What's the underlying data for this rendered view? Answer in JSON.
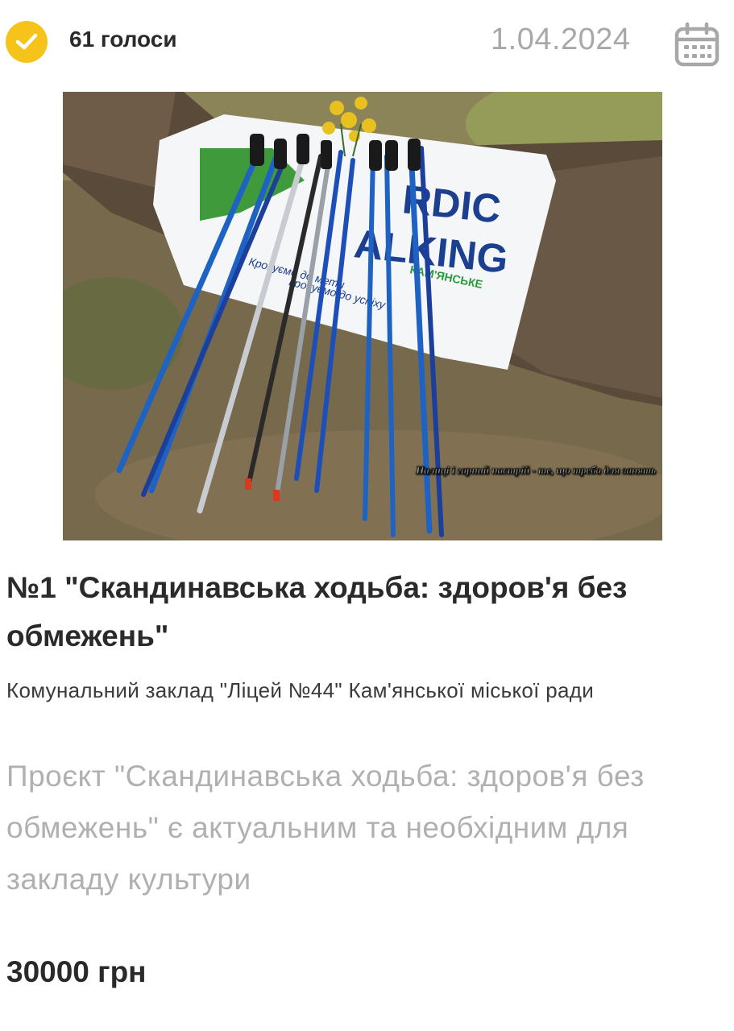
{
  "header": {
    "votes": "61 голоси",
    "date": "1.04.2024",
    "check_icon": "checkmark-icon",
    "calendar_icon": "calendar-icon",
    "accent_color": "#f5c31a"
  },
  "photo": {
    "banner_text_1": "RDIC",
    "banner_text_2": "ALKING",
    "banner_text_3": "КАМ'ЯНСЬКЕ",
    "banner_text_4": "Крокуємо до мети",
    "banner_text_5": "крокуємо до успіху",
    "caption": "Палиці і гарний настрій - те, що треба для занять"
  },
  "project": {
    "title": "№1 \"Скандинавська ходьба: здоров'я без обмежень\"",
    "organization": "Комунальний заклад \"Ліцей №44\" Кам'янської міської ради",
    "description": "Проєкт \"Скандинавська ходьба: здоров'я без обмежень\" є актуальним та необхідним для закладу культури",
    "budget": "30000 грн"
  }
}
